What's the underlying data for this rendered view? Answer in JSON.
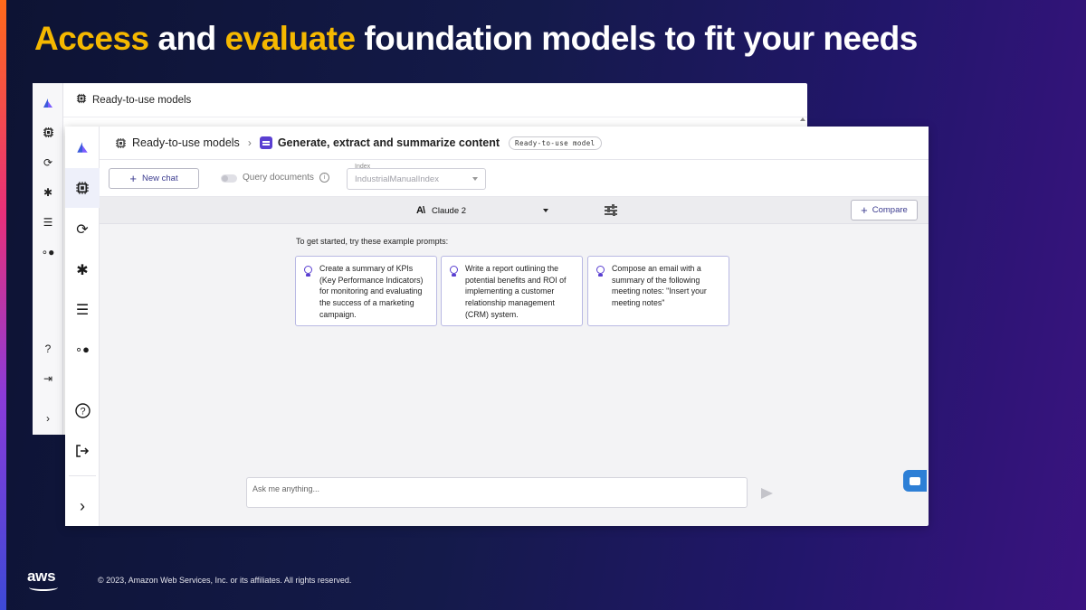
{
  "slide": {
    "title_part1": "Access",
    "title_part2": " and ",
    "title_part3": "evaluate",
    "title_part4": " foundation models to fit your needs",
    "copyright": "© 2023, Amazon Web Services, Inc. or its affiliates. All rights reserved.",
    "logo_text": "aws"
  },
  "back_window": {
    "header_title": "Ready-to-use models"
  },
  "front_window": {
    "breadcrumb": {
      "parent": "Ready-to-use models",
      "current": "Generate, extract and summarize content",
      "badge": "Ready-to-use model"
    },
    "toolbar": {
      "new_chat_label": "New chat",
      "query_documents_label": "Query documents",
      "index_label": "Index",
      "index_value": "IndustrialManualIndex"
    },
    "model_bar": {
      "model_name": "Claude 2",
      "model_logo": "A\\",
      "compare_label": "Compare"
    },
    "prompts": {
      "title": "To get started, try these example prompts:",
      "items": [
        "Create a summary of KPIs (Key Performance Indicators) for monitoring and evaluating the success of a marketing campaign.",
        "Write a report outlining the potential benefits and ROI of implementing a customer relationship management (CRM) system.",
        "Compose an email with a summary of the following meeting notes: \"Insert your meeting notes\""
      ]
    },
    "chat_input": {
      "placeholder": "Ask me anything..."
    }
  },
  "colors": {
    "accent": "#5a3fd1",
    "title_highlight": "#f5b800",
    "feedback_button": "#2d7fd6"
  }
}
